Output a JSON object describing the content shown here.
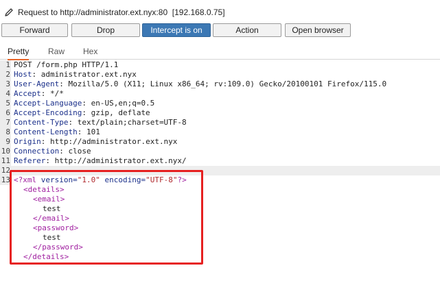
{
  "request": {
    "text": "Request to http://administrator.ext.nyx:80",
    "ip": "[192.168.0.75]",
    "icon": "pencil-icon"
  },
  "toolbar": {
    "forward": "Forward",
    "drop": "Drop",
    "intercept": "Intercept is on",
    "action": "Action",
    "open_browser": "Open browser"
  },
  "tabs": {
    "pretty": "Pretty",
    "raw": "Raw",
    "hex": "Hex"
  },
  "editor": {
    "lines": [
      {
        "num": "1",
        "text": "POST /form.php HTTP/1.1"
      },
      {
        "num": "2",
        "name": "Host",
        "value": " administrator.ext.nyx"
      },
      {
        "num": "3",
        "name": "User-Agent",
        "value": " Mozilla/5.0 (X11; Linux x86_64; rv:109.0) Gecko/20100101 Firefox/115.0"
      },
      {
        "num": "4",
        "name": "Accept",
        "value": " */*"
      },
      {
        "num": "5",
        "name": "Accept-Language",
        "value": " en-US,en;q=0.5"
      },
      {
        "num": "6",
        "name": "Accept-Encoding",
        "value": " gzip, deflate"
      },
      {
        "num": "7",
        "name": "Content-Type",
        "value": " text/plain;charset=UTF-8"
      },
      {
        "num": "8",
        "name": "Content-Length",
        "value": " 101"
      },
      {
        "num": "9",
        "name": "Origin",
        "value": " http://administrator.ext.nyx"
      },
      {
        "num": "10",
        "name": "Connection",
        "value": " close"
      },
      {
        "num": "11",
        "name": "Referer",
        "value": " http://administrator.ext.nyx/"
      },
      {
        "num": "12",
        "text": ""
      },
      {
        "num": "13"
      }
    ],
    "xml": {
      "decl_open": "<?xml",
      "version_attr": "version=",
      "version_val": "\"1.0\"",
      "encoding_attr": "encoding=",
      "encoding_val": "\"UTF-8\"",
      "decl_close": "?>",
      "details_open": "<details>",
      "email_open": "<email>",
      "email_value": "test",
      "email_close": "</email>",
      "password_open": "<password>",
      "password_value": "test",
      "password_close": "</password>",
      "details_close": "</details>"
    }
  },
  "colors": {
    "accent": "#3c78b4",
    "tab_underline": "#e8662a",
    "highlight_box": "#e62020",
    "header_name": "#1a2f8a",
    "xml_tag": "#a020a0",
    "xml_string": "#b0282c"
  }
}
